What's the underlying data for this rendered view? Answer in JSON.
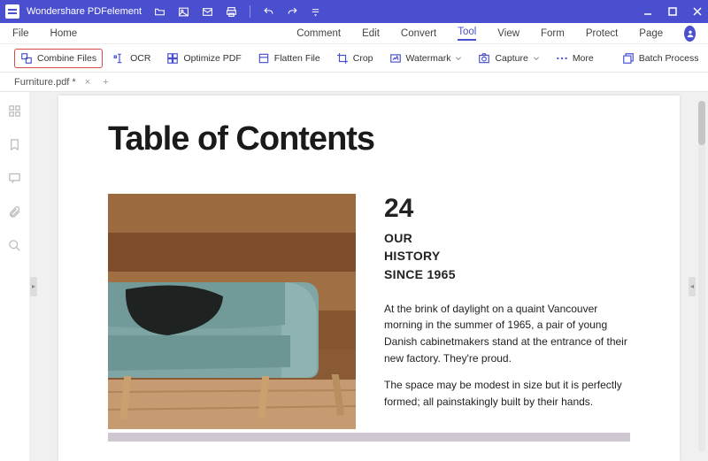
{
  "titlebar": {
    "app_name": "Wondershare PDFelement"
  },
  "menu": {
    "file": "File",
    "home": "Home",
    "comment": "Comment",
    "edit": "Edit",
    "convert": "Convert",
    "tool": "Tool",
    "view": "View",
    "form": "Form",
    "protect": "Protect",
    "page": "Page"
  },
  "toolbar": {
    "combine": "Combine Files",
    "ocr": "OCR",
    "optimize": "Optimize PDF",
    "flatten": "Flatten File",
    "crop": "Crop",
    "watermark": "Watermark",
    "capture": "Capture",
    "more": "More",
    "batch": "Batch Process"
  },
  "tab": {
    "name": "Furniture.pdf *"
  },
  "doc": {
    "heading": "Table of Contents",
    "num": "24",
    "sub1": "OUR",
    "sub2": "HISTORY",
    "sub3": "SINCE 1965",
    "p1": "At the brink of daylight on a quaint Vancouver morning in the summer of 1965, a pair of young Danish cabinetmakers stand at the entrance of their new factory. They're proud.",
    "p2": "The space may be modest in size but it is perfectly formed; all painstakingly built by their hands."
  }
}
